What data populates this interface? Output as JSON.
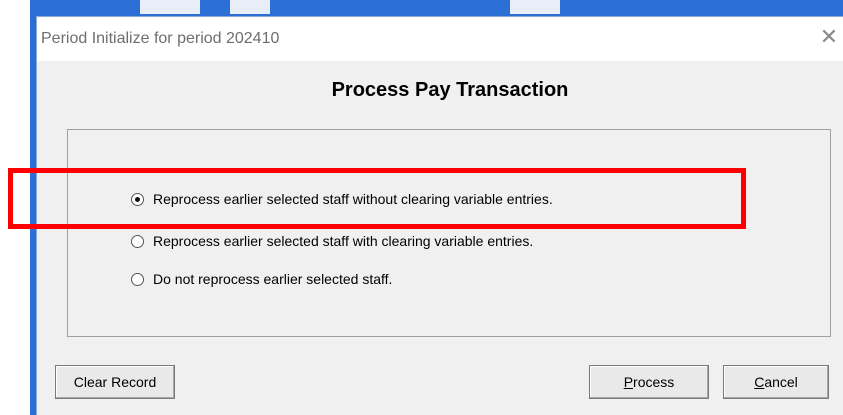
{
  "dialog": {
    "title": "Period Initialize for period 202410",
    "close_glyph": "✕",
    "heading": "Process Pay Transaction"
  },
  "options": [
    {
      "label": "Reprocess earlier selected staff without clearing variable entries.",
      "selected": true
    },
    {
      "label": "Reprocess earlier selected staff with clearing variable entries.",
      "selected": false
    },
    {
      "label": "Do not reprocess earlier selected staff.",
      "selected": false
    }
  ],
  "buttons": {
    "clear_record": "Clear Record",
    "process_first": "P",
    "process_rest": "rocess",
    "cancel_first": "C",
    "cancel_rest": "ancel"
  },
  "colors": {
    "window_accent": "#2b6fd6",
    "dialog_bg": "#f0f0f0",
    "highlight_box": "#ff0000"
  },
  "icons": {
    "close": "close-icon",
    "radio_selected": "radio-selected-icon",
    "radio_unselected": "radio-unselected-icon"
  }
}
